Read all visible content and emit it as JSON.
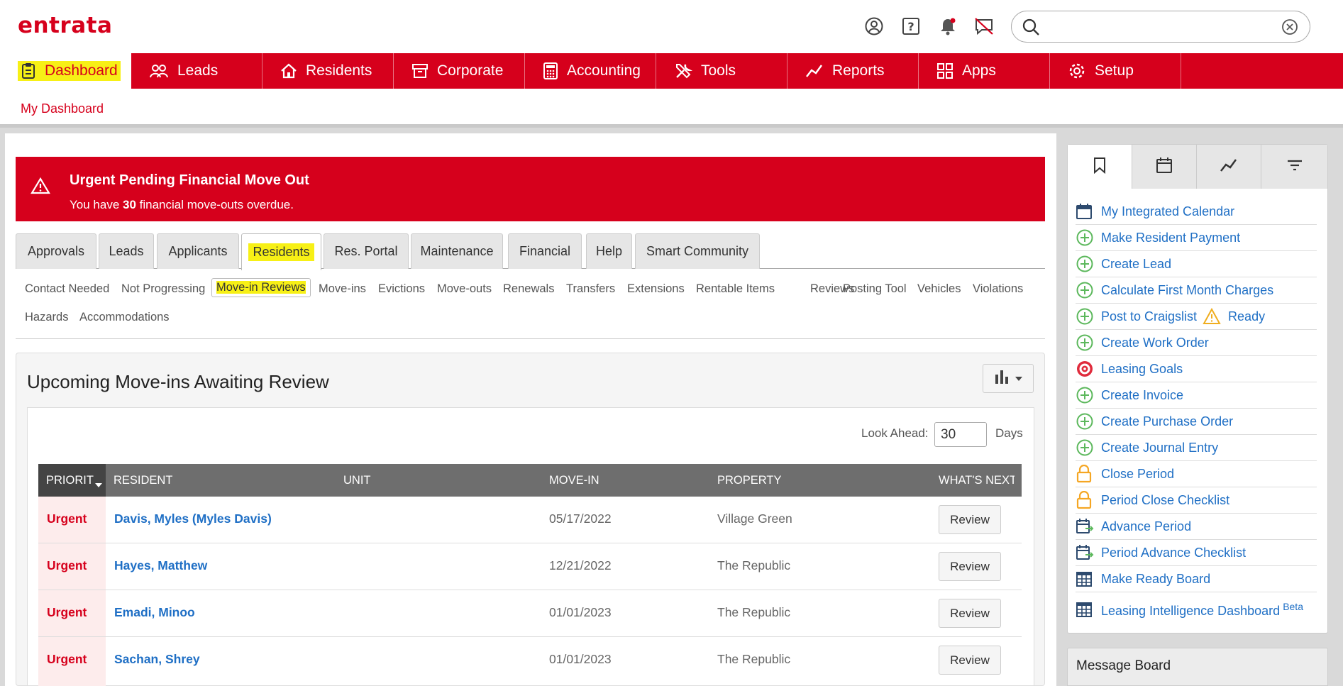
{
  "app": {
    "logo": "entrata"
  },
  "search": {
    "placeholder": ""
  },
  "nav": [
    {
      "label": "Dashboard",
      "icon": "clipboard-icon"
    },
    {
      "label": "Leads",
      "icon": "people-icon"
    },
    {
      "label": "Residents",
      "icon": "house-icon"
    },
    {
      "label": "Corporate",
      "icon": "box-icon"
    },
    {
      "label": "Accounting",
      "icon": "calculator-icon"
    },
    {
      "label": "Tools",
      "icon": "tools-icon"
    },
    {
      "label": "Reports",
      "icon": "chart-line-icon"
    },
    {
      "label": "Apps",
      "icon": "apps-icon"
    },
    {
      "label": "Setup",
      "icon": "gear-icon"
    }
  ],
  "subnav": {
    "link": "My Dashboard"
  },
  "alert": {
    "title": "Urgent Pending Financial Move Out",
    "text_before": "You have ",
    "count": "30",
    "text_after": " financial move-outs overdue."
  },
  "tabs": [
    "Approvals",
    "Leads",
    "Applicants",
    "Residents",
    "Res. Portal",
    "Maintenance",
    "Financial",
    "Help",
    "Smart Community"
  ],
  "subtabs": [
    "Contact Needed",
    "Not Progressing",
    "Move-in Reviews",
    "Move-ins",
    "Evictions",
    "Move-outs",
    "Renewals",
    "Transfers",
    "Extensions",
    "Rentable Items",
    "Reviews",
    "Posting Tool",
    "Vehicles",
    "Violations",
    "Hazards",
    "Accommodations"
  ],
  "card": {
    "title": "Upcoming Move-ins Awaiting Review",
    "lookahead_label": "Look Ahead:",
    "lookahead_value": "30",
    "days_label": "Days"
  },
  "table": {
    "headers": [
      "PRIORIT",
      "RESIDENT",
      "UNIT",
      "MOVE-IN",
      "PROPERTY",
      "WHAT'S NEXT"
    ],
    "rows": [
      {
        "priority": "Urgent",
        "resident": "Davis, Myles (Myles Davis)",
        "unit": "",
        "move_in": "05/17/2022",
        "property": "Village Green",
        "action": "Review"
      },
      {
        "priority": "Urgent",
        "resident": "Hayes, Matthew",
        "unit": "",
        "move_in": "12/21/2022",
        "property": "The Republic",
        "action": "Review"
      },
      {
        "priority": "Urgent",
        "resident": "Emadi, Minoo",
        "unit": "",
        "move_in": "01/01/2023",
        "property": "The Republic",
        "action": "Review"
      },
      {
        "priority": "Urgent",
        "resident": "Sachan, Shrey",
        "unit": "",
        "move_in": "01/01/2023",
        "property": "The Republic",
        "action": "Review"
      }
    ]
  },
  "quick_links": [
    {
      "label": "My Integrated Calendar",
      "icon": "calendar-icon"
    },
    {
      "label": "Make Resident Payment",
      "icon": "plus-circle-icon"
    },
    {
      "label": "Create Lead",
      "icon": "plus-circle-icon"
    },
    {
      "label": "Calculate First Month Charges",
      "icon": "plus-circle-icon"
    },
    {
      "label": "Post to Craigslist",
      "icon": "plus-circle-icon",
      "status": "Ready"
    },
    {
      "label": "Create Work Order",
      "icon": "plus-circle-icon"
    },
    {
      "label": "Leasing Goals",
      "icon": "target-icon"
    },
    {
      "label": "Create Invoice",
      "icon": "plus-circle-icon"
    },
    {
      "label": "Create Purchase Order",
      "icon": "plus-circle-icon"
    },
    {
      "label": "Create Journal Entry",
      "icon": "plus-circle-icon"
    },
    {
      "label": "Close Period",
      "icon": "lock-icon"
    },
    {
      "label": "Period Close Checklist",
      "icon": "lock-icon"
    },
    {
      "label": "Advance Period",
      "icon": "calendar-arrow-icon"
    },
    {
      "label": "Period Advance Checklist",
      "icon": "calendar-arrow-icon"
    },
    {
      "label": "Make Ready Board",
      "icon": "table-icon"
    },
    {
      "label": "Leasing Intelligence Dashboard",
      "icon": "table-icon",
      "badge": "Beta"
    }
  ],
  "message_board": {
    "title": "Message Board"
  },
  "colors": {
    "brand": "#d6001c",
    "link": "#1f6fc5",
    "highlight": "#f7f016"
  }
}
